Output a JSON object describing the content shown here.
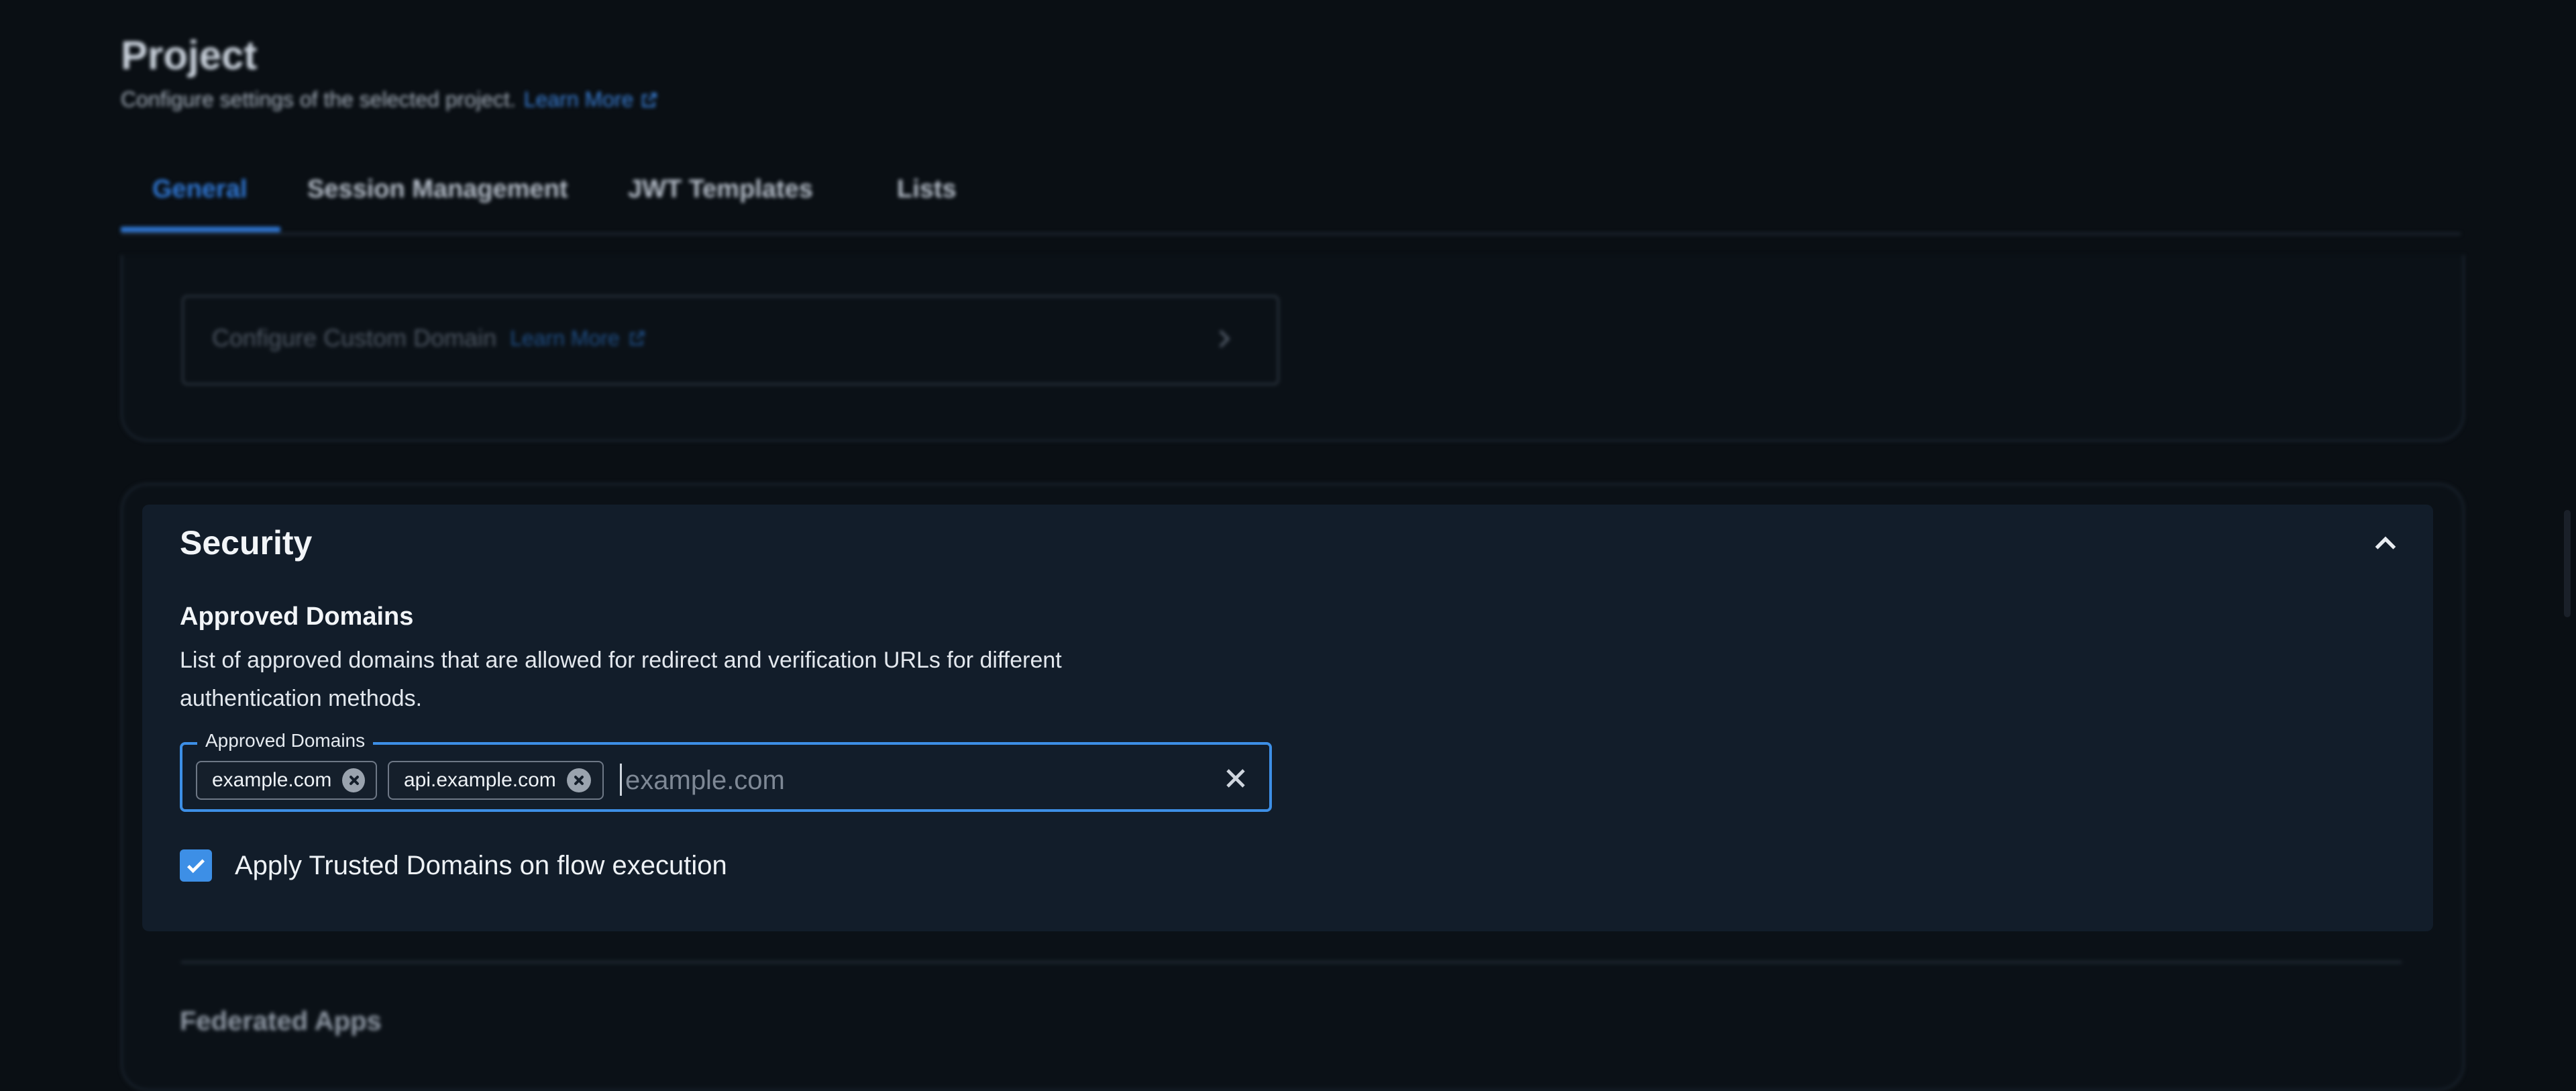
{
  "header": {
    "title": "Project",
    "subtitle": "Configure settings of the selected project.",
    "learn_more": "Learn More"
  },
  "tabs": [
    {
      "label": "General",
      "active": true
    },
    {
      "label": "Session Management",
      "active": false
    },
    {
      "label": "JWT Templates",
      "active": false
    },
    {
      "label": "Lists",
      "active": false
    }
  ],
  "custom_domain": {
    "label": "Configure Custom Domain",
    "learn_more": "Learn More"
  },
  "security": {
    "title": "Security",
    "approved_domains": {
      "title": "Approved Domains",
      "description": "List of approved domains that are allowed for redirect and verification URLs for different authentication methods.",
      "field_label": "Approved Domains",
      "chips": [
        "example.com",
        "api.example.com"
      ],
      "placeholder": "example.com",
      "value": ""
    },
    "trusted_domains_checkbox": {
      "label": "Apply Trusted Domains on flow execution",
      "checked": true
    }
  },
  "next_section": {
    "title": "Federated Apps"
  },
  "colors": {
    "accent": "#3d8fe6",
    "background": "#0a0f14",
    "panel": "#121d2a"
  },
  "icons": [
    "external-link-icon",
    "chevron-right-icon",
    "chevron-up-icon",
    "chip-remove-icon",
    "clear-icon",
    "checkmark-icon"
  ]
}
